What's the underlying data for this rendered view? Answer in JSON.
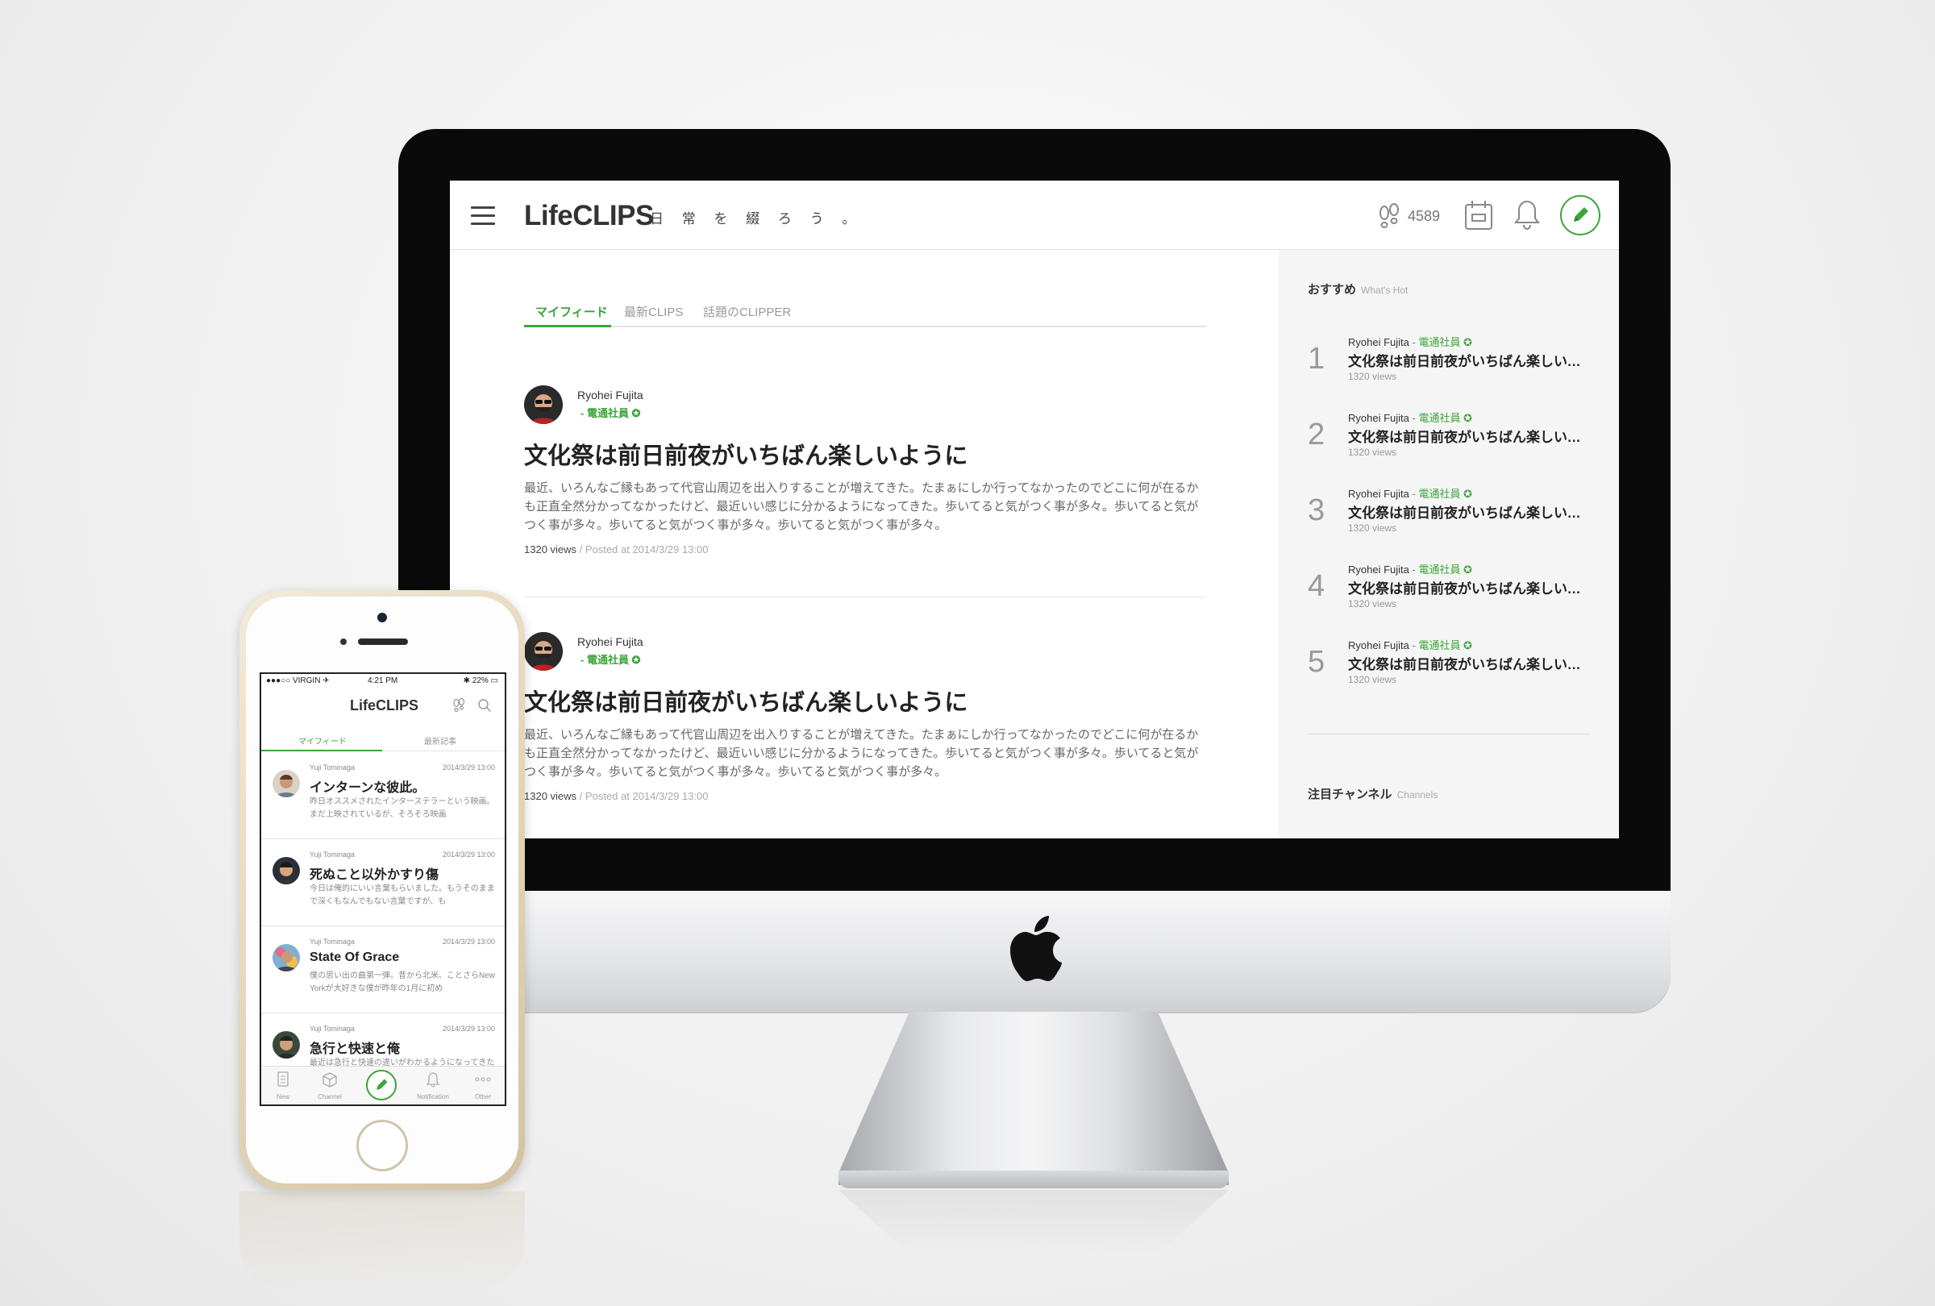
{
  "desktop": {
    "header": {
      "logo": "LifeCLIPS",
      "tagline": "日 常 を 綴 ろ う 。",
      "steps_count": "4589"
    },
    "tabs": [
      "マイフィード",
      "最新CLIPS",
      "話題のCLIPPER"
    ],
    "articles": [
      {
        "author": "Ryohei Fujita",
        "role": "- 電通社員 ✪",
        "title": "文化祭は前日前夜がいちばん楽しいように",
        "excerpt": "最近、いろんなご縁もあって代官山周辺を出入りすることが増えてきた。たまぁにしか行ってなかったのでどこに何が在るかも正直全然分かってなかったけど、最近いい感じに分かるようになってきた。歩いてると気がつく事が多々。歩いてると気がつく事が多々。歩いてると気がつく事が多々。歩いてると気がつく事が多々。",
        "views": "1320 views",
        "sep": "/",
        "posted": "Posted at 2014/3/29 13:00"
      },
      {
        "author": "Ryohei Fujita",
        "role": "- 電通社員 ✪",
        "title": "文化祭は前日前夜がいちばん楽しいように",
        "excerpt": "最近、いろんなご縁もあって代官山周辺を出入りすることが増えてきた。たまぁにしか行ってなかったのでどこに何が在るかも正直全然分かってなかったけど、最近いい感じに分かるようになってきた。歩いてると気がつく事が多々。歩いてると気がつく事が多々。歩いてると気がつく事が多々。歩いてると気がつく事が多々。",
        "views": "1320 views",
        "sep": "/",
        "posted": "Posted at 2014/3/29 13:00"
      }
    ],
    "sidebar": {
      "recommend_title": "おすすめ",
      "recommend_sub": "What's Hot",
      "ranking": [
        {
          "num": "1",
          "author": "Ryohei Fujita",
          "role": "- 電通社員 ✪",
          "title": "文化祭は前日前夜がいちばん楽しいよ…",
          "views": "1320 views"
        },
        {
          "num": "2",
          "author": "Ryohei Fujita",
          "role": "- 電通社員 ✪",
          "title": "文化祭は前日前夜がいちばん楽しいよ…",
          "views": "1320 views"
        },
        {
          "num": "3",
          "author": "Ryohei Fujita",
          "role": "- 電通社員 ✪",
          "title": "文化祭は前日前夜がいちばん楽しいよ…",
          "views": "1320 views"
        },
        {
          "num": "4",
          "author": "Ryohei Fujita",
          "role": "- 電通社員 ✪",
          "title": "文化祭は前日前夜がいちばん楽しいよ…",
          "views": "1320 views"
        },
        {
          "num": "5",
          "author": "Ryohei Fujita",
          "role": "- 電通社員 ✪",
          "title": "文化祭は前日前夜がいちばん楽しいよ…",
          "views": "1320 views"
        }
      ],
      "channels_title": "注目チャンネル",
      "channels_sub": "Channels"
    }
  },
  "phone": {
    "status": {
      "carrier": "●●●○○ VIRGIN ✈",
      "time": "4:21 PM",
      "battery": "✱ 22% ▭"
    },
    "logo": "LifeCLIPS",
    "tabs": [
      "マイフィード",
      "最新記事"
    ],
    "items": [
      {
        "author": "Yuji Tominaga",
        "date": "2014/3/29 13:00",
        "title": "インターンな彼此。",
        "excerpt": "昨日オススメされたインターステラーという映画。まだ上映されているが、そろそろ映画"
      },
      {
        "author": "Yuji Tominaga",
        "date": "2014/3/29 13:00",
        "title": "死ぬこと以外かすり傷",
        "excerpt": "今日は俺的にいい言葉もらいました。もうそのままで深くもなんでもない言葉ですが、も"
      },
      {
        "author": "Yuji Tominaga",
        "date": "2014/3/29 13:00",
        "title": "State Of Grace",
        "excerpt": "僕の思い出の曲第一弾。昔から北米、ことさらNew Yorkが大好きな僕が昨年の1月に初め"
      },
      {
        "author": "Yuji Tominaga",
        "date": "2014/3/29 13:00",
        "title": "急行と快速と俺",
        "excerpt": "最近は急行と快速の違いがわかるようになってきた"
      }
    ],
    "tabbar": [
      "New",
      "Channel",
      "",
      "Notification",
      "Other"
    ]
  },
  "colors": {
    "accent": "#3aa53a",
    "bezel": "#0a0a0a"
  },
  "icons": [
    "hamburger-icon",
    "footsteps-icon",
    "calendar-icon",
    "bell-icon",
    "pencil-icon",
    "search-icon",
    "apple-logo"
  ]
}
